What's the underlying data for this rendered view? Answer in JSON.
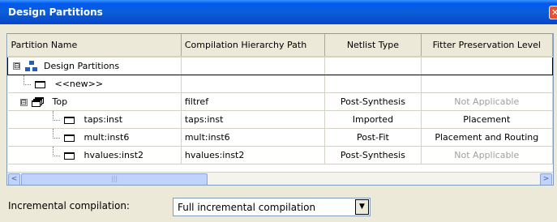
{
  "window": {
    "title": "Design Partitions",
    "close_glyph": "✕"
  },
  "table": {
    "columns": [
      "Partition Name",
      "Compilation Hierarchy Path",
      "Netlist Type",
      "Fitter Preservation Level"
    ],
    "rows": [
      {
        "name": "Design Partitions",
        "path": "",
        "netlist": "",
        "fitter": "",
        "expander": "⊟"
      },
      {
        "name": "<<new>>",
        "path": "",
        "netlist": "",
        "fitter": ""
      },
      {
        "name": "Top",
        "path": "filtref",
        "netlist": "Post-Synthesis",
        "fitter": "Not Applicable",
        "expander": "⊟"
      },
      {
        "name": "taps:inst",
        "path": "taps:inst",
        "netlist": "Imported",
        "fitter": "Placement"
      },
      {
        "name": "mult:inst6",
        "path": "mult:inst6",
        "netlist": "Post-Fit",
        "fitter": "Placement and Routing"
      },
      {
        "name": "hvalues:inst2",
        "path": "hvalues:inst2",
        "netlist": "Post-Synthesis",
        "fitter": "Not Applicable"
      }
    ]
  },
  "scrollbar": {
    "left_arrow": "<",
    "right_arrow": ">",
    "grip": "|||"
  },
  "incremental": {
    "label": "Incremental compilation:",
    "value": "Full incremental compilation",
    "arrow": "▼"
  }
}
